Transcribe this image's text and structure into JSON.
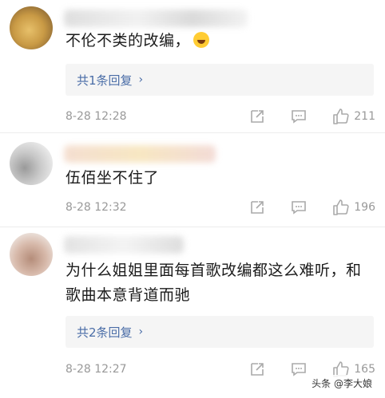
{
  "comments": [
    {
      "text": "不伦不类的改编，",
      "emoji": "laughing-tears-emoji",
      "reply_label": "共1条回复",
      "time": "8-28 12:28",
      "likes": "211"
    },
    {
      "text": "伍佰坐不住了",
      "reply_label": "",
      "time": "8-28 12:32",
      "likes": "196"
    },
    {
      "text_line1": "为什么姐姐里面每首歌改编都这么难听，和",
      "text_line2": "歌曲本意背道而驰",
      "reply_label": "共2条回复",
      "time": "8-28 12:27",
      "likes": "165"
    }
  ],
  "reply_chevron": "›",
  "watermark": "头条 @李大娘",
  "icons": {
    "share": "share-icon",
    "comment": "comment-icon",
    "like": "thumbs-up-icon"
  },
  "colors": {
    "link": "#4a6da7",
    "meta": "#999999",
    "reply_bg": "#f5f5f5"
  }
}
